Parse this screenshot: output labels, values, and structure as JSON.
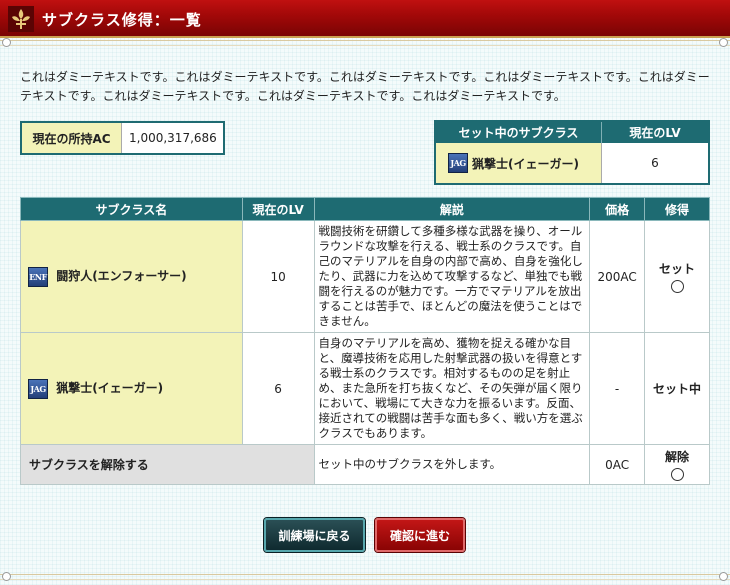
{
  "header": {
    "title": "サブクラス修得：一覧"
  },
  "intro": "これはダミーテキストです。これはダミーテキストです。これはダミーテキストです。これはダミーテキストです。これはダミーテキストです。これはダミーテキストです。これはダミーテキストです。これはダミーテキストです。",
  "ac": {
    "label": "現在の所持AC",
    "value": "1,000,317,686"
  },
  "current_set": {
    "col_class": "セット中のサブクラス",
    "col_lv": "現在のLV",
    "badge": "JAG",
    "name": "猟撃士(イェーガー)",
    "lv": "6"
  },
  "table": {
    "headers": {
      "name": "サブクラス名",
      "lv": "現在のLV",
      "desc": "解説",
      "price": "価格",
      "action": "修得"
    },
    "rows": [
      {
        "badge": "ENF",
        "name": "闘狩人(エンフォーサー)",
        "lv": "10",
        "desc": "戦闘技術を研鑽して多種多様な武器を操り、オールラウンドな攻撃を行える、戦士系のクラスです。自己のマテリアルを自身の内部で高め、自身を強化したり、武器に力を込めて攻撃するなど、単独でも戦闘を行えるのが魅力です。一方でマテリアルを放出することは苦手で、ほとんどの魔法を使うことはできません。",
        "price": "200AC",
        "action": "セット"
      },
      {
        "badge": "JAG",
        "name": "猟撃士(イェーガー)",
        "lv": "6",
        "desc": "自身のマテリアルを高め、獲物を捉える確かな目と、魔導技術を応用した射撃武器の扱いを得意とする戦士系のクラスです。相対するものの足を射止め、また急所を打ち抜くなど、その矢弾が届く限りにおいて、戦場にて大きな力を振るいます。反面、接近されての戦闘は苦手な面も多く、戦い方を選ぶクラスでもあります。",
        "price": "-",
        "action": "セット中"
      }
    ],
    "remove_row": {
      "label": "サブクラスを解除する",
      "desc": "セット中のサブクラスを外します。",
      "price": "0AC",
      "action": "解除"
    }
  },
  "buttons": {
    "back": "訓練場に戻る",
    "next": "確認に進む"
  },
  "colors": {
    "title_red": "#a00808",
    "teal": "#1e6b72",
    "name_yellow": "#f3f3b8",
    "next_red": "#b00c0c"
  }
}
